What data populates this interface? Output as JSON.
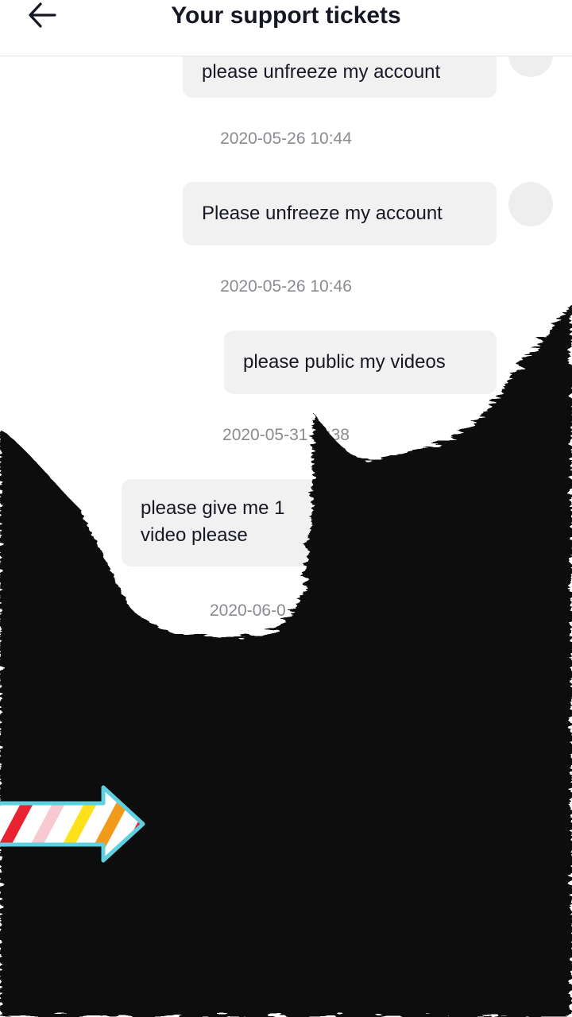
{
  "header": {
    "title": "Your support tickets",
    "back_icon": "arrow-left-icon"
  },
  "messages": [
    {
      "text": "please unfreeze my account",
      "timestamp": "2020-05-26 10:44"
    },
    {
      "text": "Please unfreeze my account",
      "timestamp": "2020-05-26 10:46"
    },
    {
      "text": "please public my videos",
      "timestamp": "2020-05-31 1 :38"
    },
    {
      "text": "please give me 1",
      "text_line2": "video please",
      "timestamp": "2020-06-0"
    }
  ],
  "overlay": {
    "fill_color": "#0d0909",
    "arrow_icon": "striped-arrow-right-icon"
  }
}
